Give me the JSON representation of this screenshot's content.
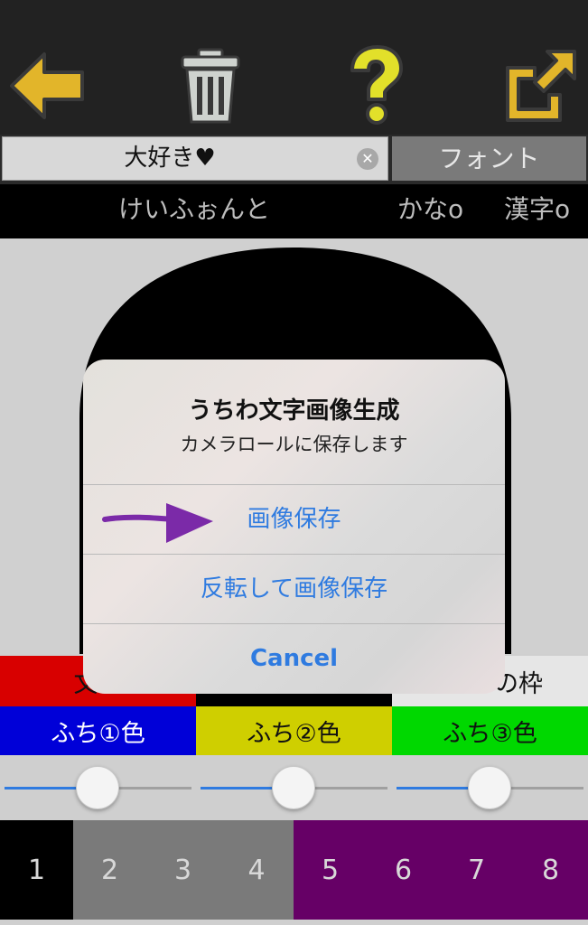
{
  "toolbar": {
    "back_icon": "arrow-left-icon",
    "trash_icon": "trash-icon",
    "help_icon": "question-icon",
    "share_icon": "share-icon"
  },
  "text_row": {
    "value": "大好き♥",
    "font_button": "フォント"
  },
  "font_row": {
    "font_name": "けいふぉんと",
    "kana_toggle": "かなo",
    "kanji_toggle": "漢字o"
  },
  "color_row_a": {
    "left": "文字",
    "right": "の枠"
  },
  "color_row_b": {
    "border1": "ふち①色",
    "border2": "ふち②色",
    "border3": "ふち③色"
  },
  "tabs": [
    "1",
    "2",
    "3",
    "4",
    "5",
    "6",
    "7",
    "8"
  ],
  "sliders": [
    0.5,
    0.5,
    0.5
  ],
  "dialog": {
    "title": "うちわ文字画像生成",
    "message": "カメラロールに保存します",
    "save": "画像保存",
    "save_flipped": "反転して画像保存",
    "cancel": "Cancel"
  },
  "colors": {
    "accent_yellow": "#e2b52a",
    "link_blue": "#2f7be0",
    "arrow_purple": "#7b2aa8",
    "red": "#d80000",
    "blue": "#0000d8",
    "yellow": "#cfcf00",
    "green": "#00d800",
    "purple": "#660066"
  }
}
